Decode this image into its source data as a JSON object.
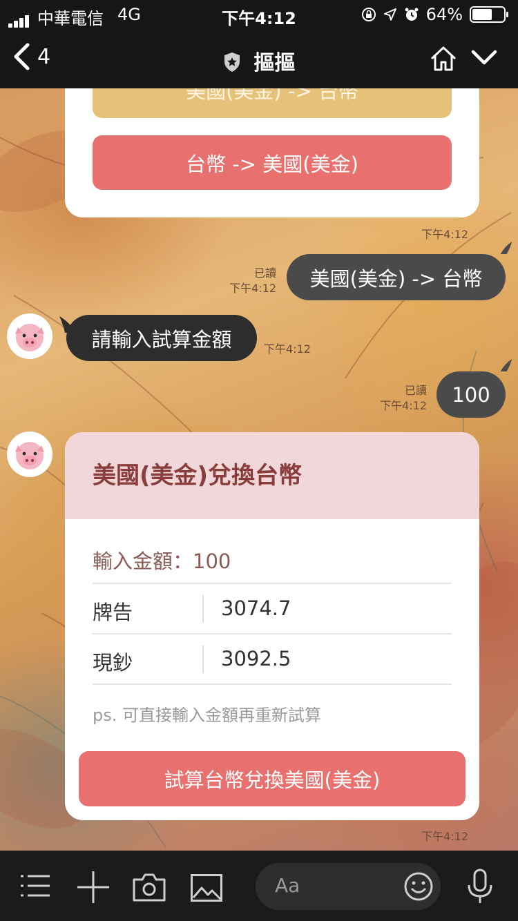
{
  "status_bar": {
    "carrier": "中華電信",
    "network": "4G",
    "time": "下午4:12",
    "battery": "64%",
    "battery_level": 0.64
  },
  "nav": {
    "back_count": "4",
    "title": "摳摳"
  },
  "chat": {
    "card_top": {
      "button_partial": "美國(美金) -> 台幣",
      "button_main": "台幣 -> 美國(美金)",
      "time": "下午4:12"
    },
    "msg_user_1": {
      "text": "美國(美金) -> 台幣",
      "read": "已讀",
      "time": "下午4:12"
    },
    "msg_bot_1": {
      "text": "請輸入試算金額",
      "time": "下午4:12"
    },
    "msg_user_2": {
      "text": "100",
      "read": "已讀",
      "time": "下午4:12"
    },
    "flex_card": {
      "title": "美國(美金)兌換台幣",
      "input_amount": "輸入金額：100",
      "rows": [
        {
          "label": "牌告",
          "value": "3074.7"
        },
        {
          "label": "現鈔",
          "value": "3092.5"
        }
      ],
      "note": "ps. 可直接輸入金額再重新試算",
      "button": "試算台幣兌換美國(美金)",
      "time": "下午4:12"
    }
  },
  "bottom_bar": {
    "input_placeholder": "Aa"
  },
  "colors": {
    "button_red": "#e8706e",
    "button_yellow": "#e6c17a",
    "flex_header_bg": "#f1d7d9",
    "flex_title": "#8a3d3d"
  }
}
